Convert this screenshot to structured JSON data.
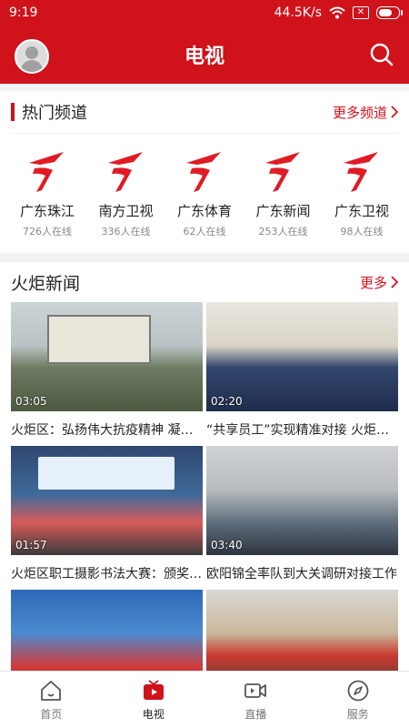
{
  "status": {
    "time": "9:19",
    "speed": "44.5K/s"
  },
  "header": {
    "title": "电视"
  },
  "hot": {
    "title": "热门频道",
    "more": "更多频道",
    "channels": [
      {
        "name": "广东珠江",
        "online": "726人在线"
      },
      {
        "name": "南方卫视",
        "online": "336人在线"
      },
      {
        "name": "广东体育",
        "online": "62人在线"
      },
      {
        "name": "广东新闻",
        "online": "253人在线"
      },
      {
        "name": "广东卫视",
        "online": "98人在线"
      }
    ]
  },
  "news": {
    "title": "火炬新闻",
    "more": "更多",
    "items": [
      {
        "duration": "03:05",
        "caption": "火炬区：弘扬伟大抗疫精神 凝聚发展合力"
      },
      {
        "duration": "02:20",
        "caption": "“共享员工”实现精准对接 火炬区企业用工"
      },
      {
        "duration": "01:57",
        "caption": "火炬区职工摄影书法大赛：颁奖典礼举行"
      },
      {
        "duration": "03:40",
        "caption": "欧阳锦全率队到大关调研对接工作"
      },
      {
        "duration": "",
        "caption": ""
      },
      {
        "duration": "",
        "caption": ""
      }
    ]
  },
  "tabs": [
    {
      "label": "首页"
    },
    {
      "label": "电视"
    },
    {
      "label": "直播"
    },
    {
      "label": "服务"
    }
  ],
  "colors": {
    "brand": "#d0121b"
  }
}
